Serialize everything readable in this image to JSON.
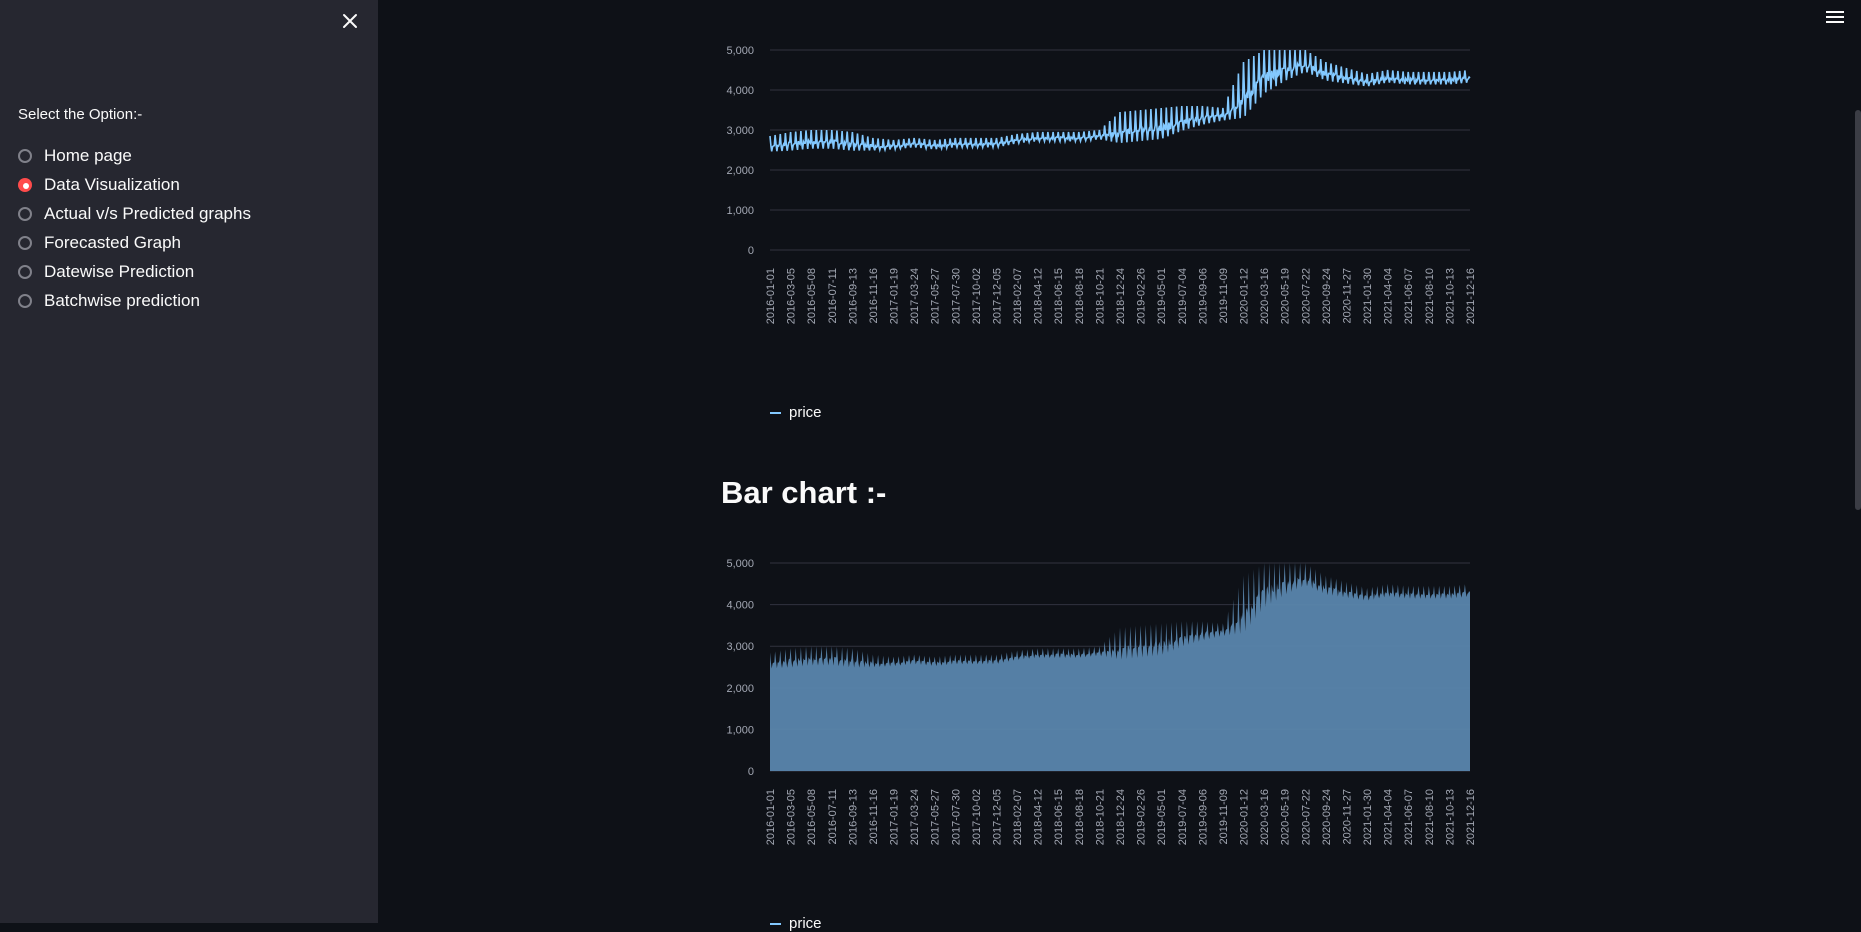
{
  "sidebar": {
    "close_icon": "close-icon",
    "label": "Select the Option:-",
    "options": [
      {
        "label": "Home page",
        "selected": false
      },
      {
        "label": "Data Visualization",
        "selected": true
      },
      {
        "label": "Actual v/s Predicted graphs",
        "selected": false
      },
      {
        "label": "Forecasted Graph",
        "selected": false
      },
      {
        "label": "Datewise Prediction",
        "selected": false
      },
      {
        "label": "Batchwise prediction",
        "selected": false
      }
    ]
  },
  "header": {
    "menu_icon": "hamburger-menu-icon"
  },
  "main": {
    "bar_heading": "Bar chart :-"
  },
  "colors": {
    "accent": "#ff4b4b",
    "series": "#83c9ff",
    "area_fill": "#5a86ad",
    "background": "#0e1117",
    "sidebar": "#262730"
  },
  "chart_data": [
    {
      "type": "line",
      "series": [
        {
          "name": "price",
          "color": "#83c9ff"
        }
      ],
      "x_tick_labels": [
        "2016-01-01",
        "2016-03-05",
        "2016-05-08",
        "2016-07-11",
        "2016-09-13",
        "2016-11-16",
        "2017-01-19",
        "2017-03-24",
        "2017-05-27",
        "2017-07-30",
        "2017-10-02",
        "2017-12-05",
        "2018-02-07",
        "2018-04-12",
        "2018-06-15",
        "2018-08-18",
        "2018-10-21",
        "2018-12-24",
        "2019-02-26",
        "2019-05-01",
        "2019-07-04",
        "2019-09-06",
        "2019-11-09",
        "2020-01-12",
        "2020-03-16",
        "2020-05-19",
        "2020-07-22",
        "2020-09-24",
        "2020-11-27",
        "2021-01-30",
        "2021-04-04",
        "2021-06-07",
        "2021-08-10",
        "2021-10-13",
        "2021-12-16"
      ],
      "y_ticks": [
        "0",
        "1,000",
        "2,000",
        "3,000",
        "4,000",
        "5,000"
      ],
      "ylim": [
        0,
        5000
      ],
      "grid": true,
      "legend": "bottom-left",
      "approx_level_at_ticks": [
        2600,
        2650,
        2700,
        2700,
        2650,
        2600,
        2600,
        2650,
        2600,
        2650,
        2650,
        2650,
        2750,
        2800,
        2800,
        2800,
        2850,
        2950,
        3000,
        3050,
        3200,
        3300,
        3350,
        3800,
        4300,
        4500,
        4650,
        4400,
        4300,
        4200,
        4300,
        4250,
        4250,
        4250,
        4300
      ],
      "spike_height_at_ticks": [
        250,
        300,
        300,
        300,
        300,
        200,
        150,
        150,
        150,
        150,
        150,
        150,
        150,
        150,
        150,
        150,
        150,
        500,
        500,
        500,
        400,
        300,
        200,
        900,
        700,
        500,
        350,
        300,
        250,
        200,
        200,
        200,
        200,
        200,
        200
      ]
    },
    {
      "type": "area",
      "series": [
        {
          "name": "price",
          "color": "#5a86ad"
        }
      ],
      "x_tick_labels": [
        "2016-01-01",
        "2016-03-05",
        "2016-05-08",
        "2016-07-11",
        "2016-09-13",
        "2016-11-16",
        "2017-01-19",
        "2017-03-24",
        "2017-05-27",
        "2017-07-30",
        "2017-10-02",
        "2017-12-05",
        "2018-02-07",
        "2018-04-12",
        "2018-06-15",
        "2018-08-18",
        "2018-10-21",
        "2018-12-24",
        "2019-02-26",
        "2019-05-01",
        "2019-07-04",
        "2019-09-06",
        "2019-11-09",
        "2020-01-12",
        "2020-03-16",
        "2020-05-19",
        "2020-07-22",
        "2020-09-24",
        "2020-11-27",
        "2021-01-30",
        "2021-04-04",
        "2021-06-07",
        "2021-08-10",
        "2021-10-13",
        "2021-12-16"
      ],
      "y_ticks": [
        "0",
        "1,000",
        "2,000",
        "3,000",
        "4,000",
        "5,000"
      ],
      "ylim": [
        0,
        5000
      ],
      "grid": true,
      "legend": "bottom-left",
      "approx_level_at_ticks": [
        2600,
        2650,
        2700,
        2700,
        2650,
        2600,
        2600,
        2650,
        2600,
        2650,
        2650,
        2650,
        2750,
        2800,
        2800,
        2800,
        2850,
        2950,
        3000,
        3050,
        3200,
        3300,
        3350,
        3800,
        4300,
        4500,
        4650,
        4400,
        4300,
        4200,
        4300,
        4250,
        4250,
        4250,
        4300
      ],
      "spike_height_at_ticks": [
        250,
        300,
        300,
        300,
        300,
        200,
        150,
        150,
        150,
        150,
        150,
        150,
        150,
        150,
        150,
        150,
        150,
        500,
        500,
        500,
        400,
        300,
        200,
        900,
        700,
        500,
        350,
        300,
        250,
        200,
        200,
        200,
        200,
        200,
        200
      ]
    }
  ]
}
